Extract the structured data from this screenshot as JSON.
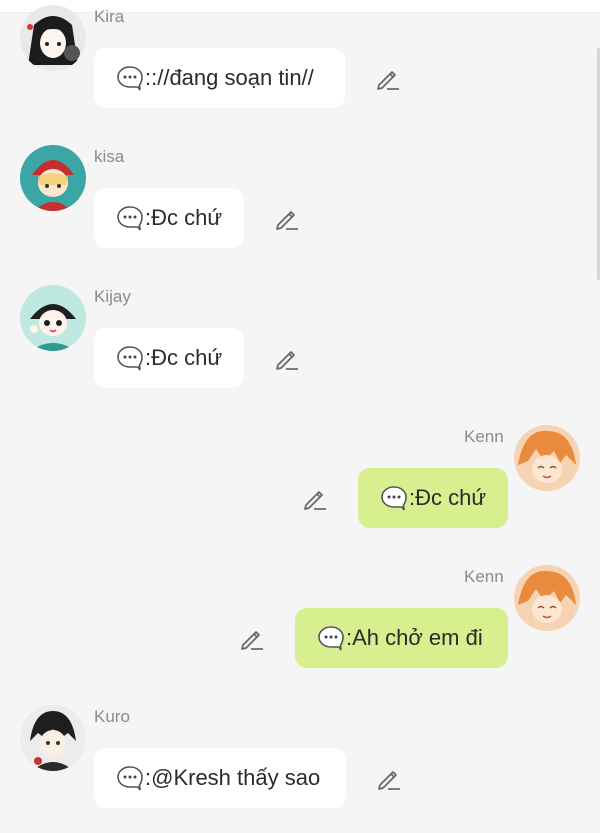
{
  "messages": [
    {
      "sender": "Kira",
      "side": "left",
      "text": ":://đang soạn tin//",
      "avatar_icon": "kira-avatar",
      "action_icon": "pencil-icon"
    },
    {
      "sender": "kisa",
      "side": "left",
      "text": ":Đc chứ",
      "avatar_icon": "kisa-avatar",
      "action_icon": "pencil-icon"
    },
    {
      "sender": "Kijay",
      "side": "left",
      "text": ":Đc chứ",
      "avatar_icon": "kijay-avatar",
      "action_icon": "pencil-icon"
    },
    {
      "sender": "Kenn",
      "side": "right",
      "text": ":Đc chứ",
      "avatar_icon": "kenn-avatar",
      "action_icon": "pencil-icon"
    },
    {
      "sender": "Kenn",
      "side": "right",
      "text": ":Ah chở em đi",
      "avatar_icon": "kenn-avatar",
      "action_icon": "pencil-icon"
    },
    {
      "sender": "Kuro",
      "side": "left",
      "text": ":@Kresh thấy sao",
      "avatar_icon": "kuro-avatar",
      "action_icon": "pencil-icon"
    }
  ],
  "colors": {
    "background": "#f5f5f5",
    "bubble_incoming": "#ffffff",
    "bubble_outgoing": "#d7ef8e",
    "name_text": "#8b8b8b",
    "message_text": "#2b2b2b"
  }
}
